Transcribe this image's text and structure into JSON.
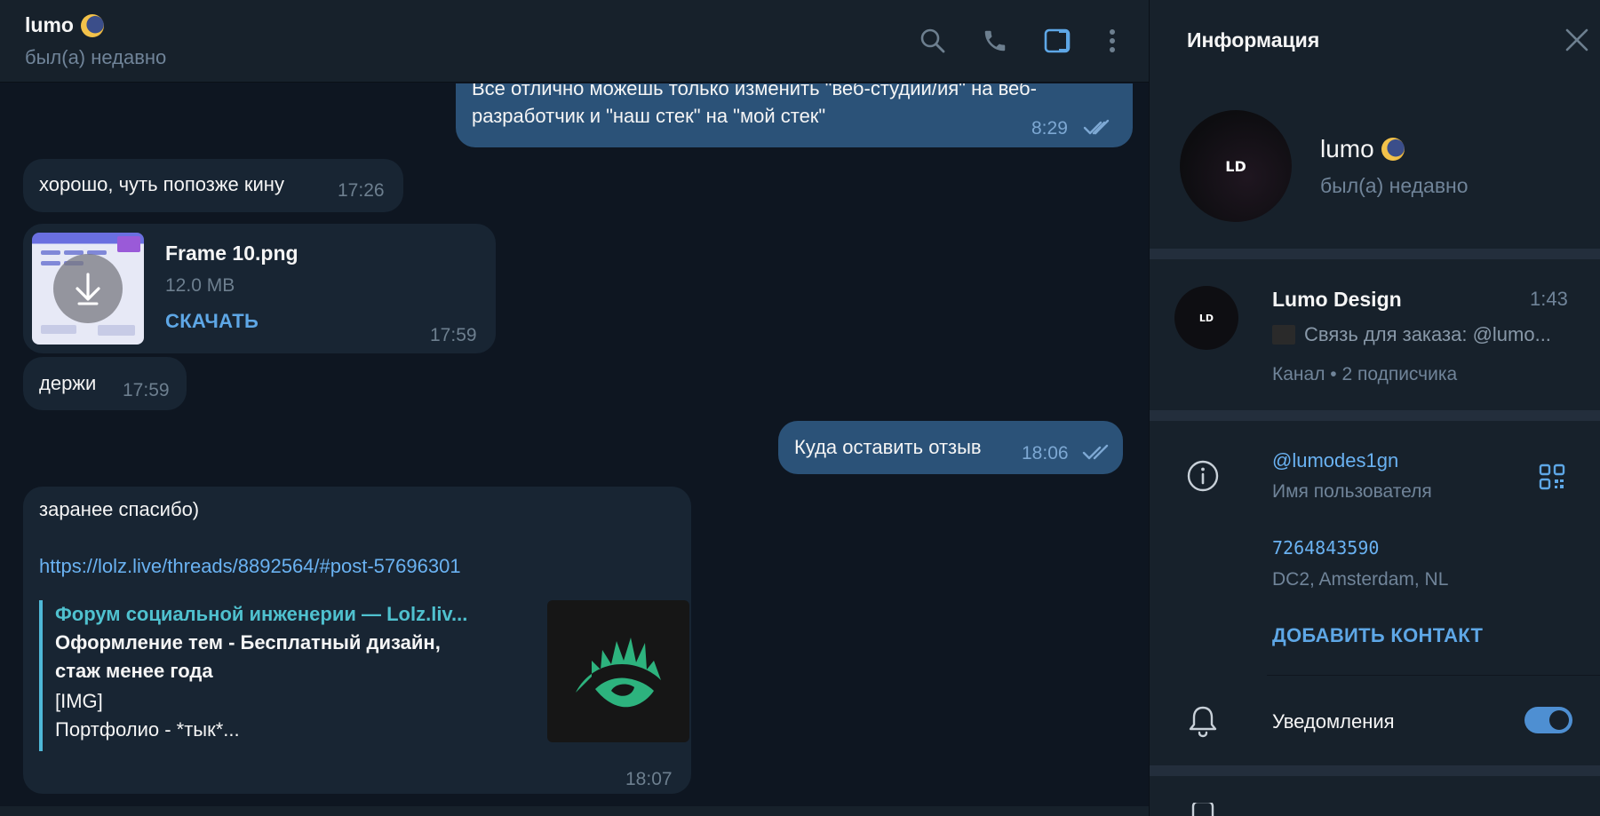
{
  "chat": {
    "name": "lumo",
    "status": "был(а) недавно"
  },
  "messages": [
    {
      "type": "out",
      "text": "Все отлично можешь только изменить \"веб-студии/ия\" на веб-разработчик и \"наш стек\" на \"мой стек\"",
      "time": "8:29"
    },
    {
      "type": "in",
      "text": "хорошо, чуть попозже кину",
      "time": "17:26"
    },
    {
      "type": "file",
      "file_name": "Frame 10.png",
      "file_size": "12.0 MB",
      "download_label": "СКАЧАТЬ",
      "time": "17:59"
    },
    {
      "type": "in",
      "text": "держи",
      "time": "17:59"
    },
    {
      "type": "out",
      "text": "Куда оставить отзыв",
      "time": "18:06"
    },
    {
      "type": "in",
      "text": "заранее спасибо)",
      "link": "https://lolz.live/threads/8892564/#post-57696301",
      "preview_site": "Форум социальной инженерии —  Lolz.liv...",
      "preview_title": "Оформление тем - Бесплатный дизайн, стаж менее года",
      "preview_text_1": "[IMG]",
      "preview_text_2": "Портфолио - *тык*...",
      "time": "18:07"
    }
  ],
  "info": {
    "title": "Информация",
    "name": "lumo",
    "status": "был(а) недавно",
    "avatar_text": "LD",
    "channel": {
      "name": "Lumo Design",
      "time": "1:43",
      "last_message": "Связь для заказа: @lumo...",
      "meta": "Канал • 2 подписчика"
    },
    "username": "@lumodes1gn",
    "username_label": "Имя пользователя",
    "phone": "7264843590",
    "dc": "DC2, Amsterdam, NL",
    "add_contact": "ДОБАВИТЬ КОНТАКТ",
    "notifications_label": "Уведомления",
    "notifications_on": true
  },
  "colors": {
    "chat_bg": "#0e1621",
    "panel_bg": "#17212b",
    "bubble_in": "#182533",
    "bubble_out": "#2b5278",
    "accent": "#6ab2f2"
  },
  "icons": [
    "search-icon",
    "phone-icon",
    "sidebar-toggle-icon",
    "more-icon",
    "close-icon",
    "info-icon",
    "qr-code-icon",
    "bell-icon",
    "download-icon",
    "double-check-icon",
    "moon-emoji-icon"
  ]
}
